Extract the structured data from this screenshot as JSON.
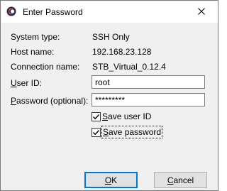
{
  "window": {
    "title": "Enter Password",
    "icon": "eclipse-app-icon",
    "close_icon": "close-icon"
  },
  "info": {
    "system_type_label": "System type:",
    "system_type_value": "SSH Only",
    "host_name_label": "Host name:",
    "host_name_value": "192.168.23.128",
    "connection_name_label": "Connection name:",
    "connection_name_value": "STB_Virtual_0.12.4"
  },
  "form": {
    "user_id_label_mnemonic": "U",
    "user_id_label_rest": "ser ID:",
    "user_id_value": "root",
    "password_label_mnemonic": "P",
    "password_label_rest": "assword (optional):",
    "password_value": "*********",
    "save_user_id_mnemonic": "S",
    "save_user_id_rest": "ave user ID",
    "save_user_id_checked": true,
    "save_password_mnemonic": "S",
    "save_password_rest": "ave password",
    "save_password_checked": true
  },
  "buttons": {
    "ok_mnemonic": "O",
    "ok_rest": "K",
    "cancel_mnemonic": "C",
    "cancel_rest": "ancel"
  },
  "colors": {
    "accent": "#0078d7",
    "dialog_background": "#f0f0f0"
  }
}
